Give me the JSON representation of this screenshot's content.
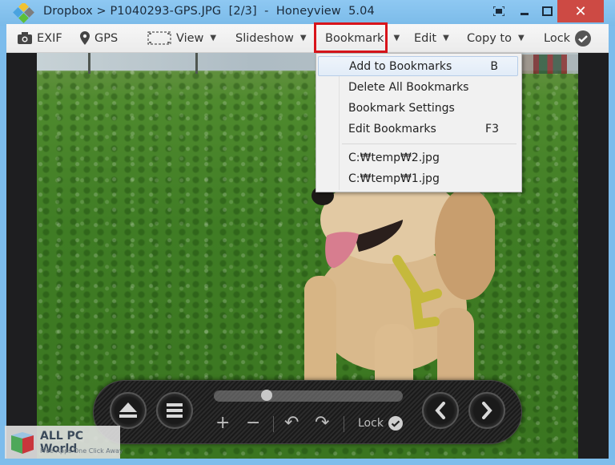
{
  "window": {
    "title": "Dropbox > P1040293-GPS.JPG  [2/3]  -  Honeyview  5.04",
    "controls": {
      "fit_icon": "fullscreen-icon",
      "minimize_icon": "minimize-icon",
      "maximize_icon": "maximize-icon",
      "close_label": "✕"
    }
  },
  "toolbar": {
    "items": [
      {
        "label": "EXIF",
        "icon": "camera-icon"
      },
      {
        "label": "GPS",
        "icon": "map-pin-icon"
      },
      {
        "label": "View",
        "icon": "frame-icon",
        "dropdown": true
      },
      {
        "label": "Slideshow",
        "dropdown": true
      },
      {
        "label": "Bookmark",
        "dropdown": true,
        "active": true
      },
      {
        "label": "Edit",
        "dropdown": true
      },
      {
        "label": "Copy to",
        "dropdown": true
      },
      {
        "label": "Lock",
        "icon": "check-circle-icon"
      }
    ],
    "caret": "▼"
  },
  "bookmark_menu": {
    "items": [
      {
        "label": "Add to Bookmarks",
        "shortcut": "B",
        "hover": true
      },
      {
        "label": "Delete All Bookmarks",
        "shortcut": ""
      },
      {
        "label": "Bookmark Settings",
        "shortcut": ""
      },
      {
        "label": "Edit Bookmarks",
        "shortcut": "F3"
      }
    ],
    "recent": [
      {
        "label": "C:₩temp₩2.jpg"
      },
      {
        "label": "C:₩temp₩1.jpg"
      }
    ]
  },
  "controlbar": {
    "slider_position": 0.28,
    "lock_label": "Lock",
    "buttons": [
      "eject-icon",
      "menu-icon",
      "zoom-in-icon",
      "zoom-out-icon",
      "rotate-left-icon",
      "rotate-right-icon",
      "previous-icon",
      "next-icon"
    ],
    "zoom_in": "+",
    "zoom_out": "−",
    "rotate_left": "↶",
    "rotate_right": "↷"
  },
  "watermark": {
    "title": "ALL PC World",
    "subtitle": "Free Apps One Click Away"
  },
  "colors": {
    "titlebar": "#8ec8f2",
    "close_button": "#cd4a44",
    "highlight_border": "#d8141b"
  }
}
